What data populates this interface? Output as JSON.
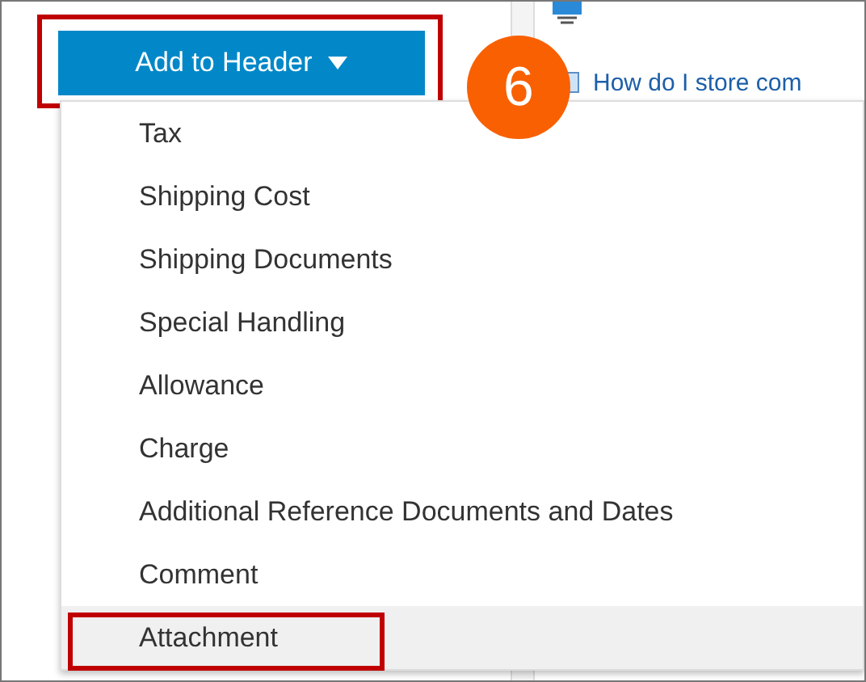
{
  "add_button": {
    "label": "Add to Header",
    "outlined": true
  },
  "step_badge": "6",
  "help_links": [
    {
      "label": "How do I store com"
    }
  ],
  "menu_items": [
    {
      "label": "Tax",
      "selected": false,
      "outlined": false
    },
    {
      "label": "Shipping Cost",
      "selected": false,
      "outlined": false
    },
    {
      "label": "Shipping Documents",
      "selected": false,
      "outlined": false
    },
    {
      "label": "Special Handling",
      "selected": false,
      "outlined": false
    },
    {
      "label": "Allowance",
      "selected": false,
      "outlined": false
    },
    {
      "label": "Charge",
      "selected": false,
      "outlined": false
    },
    {
      "label": "Additional Reference Documents and Dates",
      "selected": false,
      "outlined": false
    },
    {
      "label": "Comment",
      "selected": false,
      "outlined": false
    },
    {
      "label": "Attachment",
      "selected": true,
      "outlined": true
    }
  ]
}
